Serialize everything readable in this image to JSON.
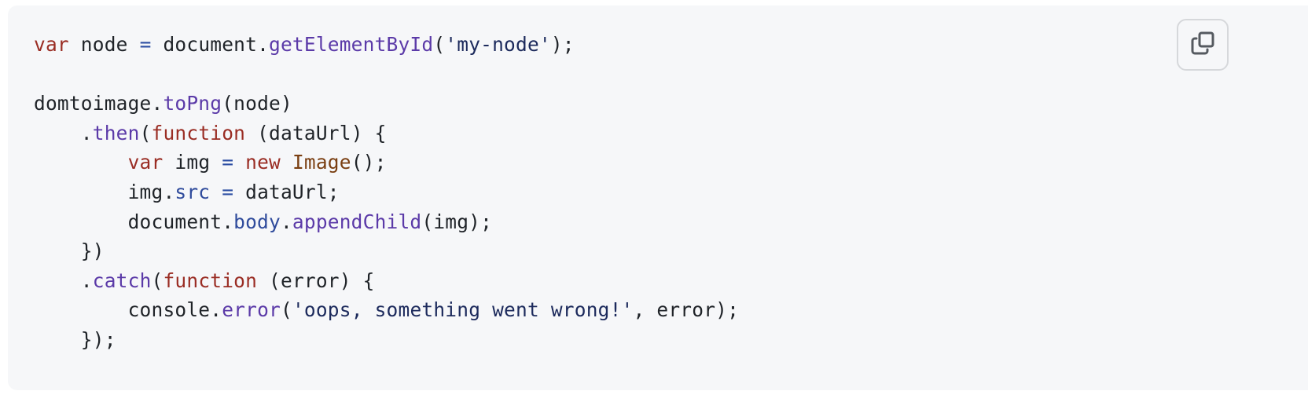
{
  "code_block": {
    "language": "javascript",
    "copy_button": {
      "icon": "copy-icon",
      "label": "Copy"
    },
    "lines": [
      [
        {
          "t": "keyword",
          "v": "var"
        },
        {
          "t": "plain",
          "v": " node "
        },
        {
          "t": "operator",
          "v": "="
        },
        {
          "t": "plain",
          "v": " document."
        },
        {
          "t": "method",
          "v": "getElementById"
        },
        {
          "t": "plain",
          "v": "("
        },
        {
          "t": "string",
          "v": "'my-node'"
        },
        {
          "t": "plain",
          "v": ");"
        }
      ],
      [],
      [
        {
          "t": "plain",
          "v": "domtoimage."
        },
        {
          "t": "method",
          "v": "toPng"
        },
        {
          "t": "plain",
          "v": "(node)"
        }
      ],
      [
        {
          "t": "plain",
          "v": "    ."
        },
        {
          "t": "method",
          "v": "then"
        },
        {
          "t": "plain",
          "v": "("
        },
        {
          "t": "keyword",
          "v": "function"
        },
        {
          "t": "plain",
          "v": " (dataUrl) {"
        }
      ],
      [
        {
          "t": "plain",
          "v": "        "
        },
        {
          "t": "keyword",
          "v": "var"
        },
        {
          "t": "plain",
          "v": " img "
        },
        {
          "t": "operator",
          "v": "="
        },
        {
          "t": "plain",
          "v": " "
        },
        {
          "t": "keyword",
          "v": "new"
        },
        {
          "t": "plain",
          "v": " "
        },
        {
          "t": "class",
          "v": "Image"
        },
        {
          "t": "plain",
          "v": "();"
        }
      ],
      [
        {
          "t": "plain",
          "v": "        img."
        },
        {
          "t": "property",
          "v": "src"
        },
        {
          "t": "plain",
          "v": " "
        },
        {
          "t": "operator",
          "v": "="
        },
        {
          "t": "plain",
          "v": " dataUrl;"
        }
      ],
      [
        {
          "t": "plain",
          "v": "        document."
        },
        {
          "t": "property",
          "v": "body"
        },
        {
          "t": "plain",
          "v": "."
        },
        {
          "t": "method",
          "v": "appendChild"
        },
        {
          "t": "plain",
          "v": "(img);"
        }
      ],
      [
        {
          "t": "plain",
          "v": "    })"
        }
      ],
      [
        {
          "t": "plain",
          "v": "    ."
        },
        {
          "t": "method",
          "v": "catch"
        },
        {
          "t": "plain",
          "v": "("
        },
        {
          "t": "keyword",
          "v": "function"
        },
        {
          "t": "plain",
          "v": " (error) {"
        }
      ],
      [
        {
          "t": "plain",
          "v": "        console."
        },
        {
          "t": "method",
          "v": "error"
        },
        {
          "t": "plain",
          "v": "("
        },
        {
          "t": "string",
          "v": "'oops, something went wrong!'"
        },
        {
          "t": "plain",
          "v": ", error);"
        }
      ],
      [
        {
          "t": "plain",
          "v": "    });"
        }
      ]
    ]
  },
  "colors": {
    "background": "#f6f7f9",
    "keyword": "#9a2d24",
    "operator": "#2c4ea3",
    "method": "#5b3aa8",
    "property": "#2f4b9c",
    "string": "#1c2a5c",
    "class": "#7a3f12",
    "plain": "#1f2328"
  }
}
